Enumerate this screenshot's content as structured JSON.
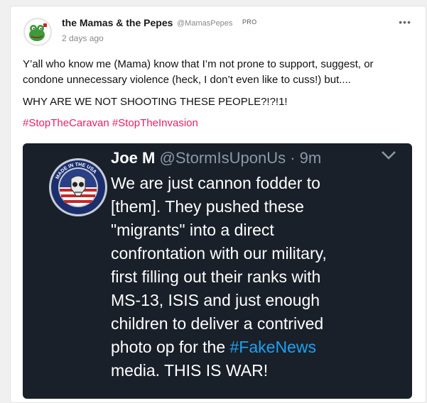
{
  "post": {
    "author_name": "the Mamas & the Pepes",
    "author_handle": "@MamasPepes",
    "badge": "PRO",
    "time": "2 days ago",
    "more_label": "•••",
    "paragraph1_line1": "Y’all who know me (Mama) know that I’m not prone to support, suggest, or",
    "paragraph1_line2": "condone unnecessary violence (heck, I don’t even like to cuss!) but....",
    "paragraph2": "WHY ARE WE NOT SHOOTING THESE PEOPLE?!?!1!",
    "hashtags": [
      "#StopTheCaravan",
      "#StopTheInvasion"
    ]
  },
  "embedded_tweet": {
    "name": "Joe M",
    "handle_time": "@StormIsUponUs · 9m",
    "seal_top_text": "MADE IN THE USA",
    "lines": [
      "We are just cannon fodder to",
      "[them]. They pushed these",
      "\"migrants\" into a direct",
      "confrontation with our military,",
      "first filling out their ranks with",
      "MS-13, ISIS and just enough",
      "children to deliver a contrived"
    ],
    "line8_before": "photo op for the ",
    "line8_hashtag": "#FakeNews",
    "line9": "media. THIS IS WAR!"
  },
  "colors": {
    "hashtag": "#e91e63",
    "tweet_bg": "#1a202a",
    "tweet_link": "#1da1f2"
  }
}
